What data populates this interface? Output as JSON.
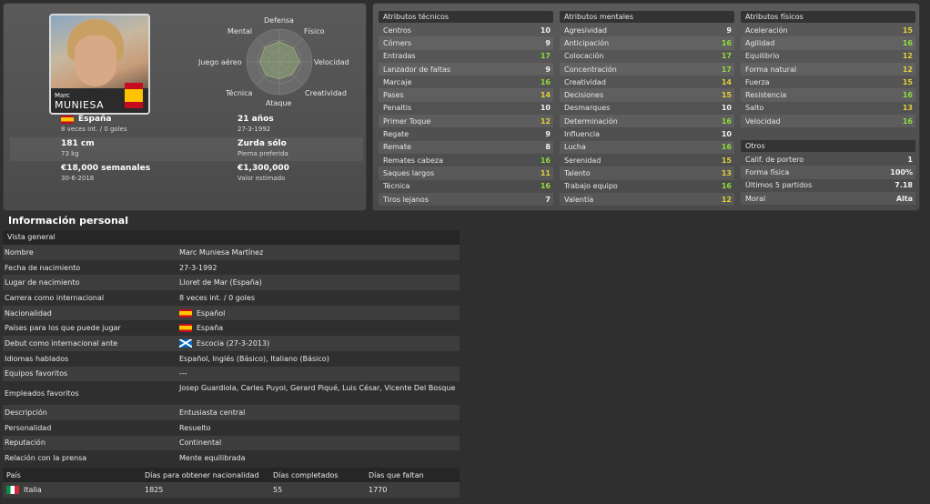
{
  "player": {
    "photo_first": "Marc",
    "photo_last": "MUNIESA",
    "nationality": "España",
    "caps": "8 veces int. / 0 goles",
    "age": "21 años",
    "dob": "27-3-1992",
    "height": "181 cm",
    "weight": "73 kg",
    "foot": "Zurda sólo",
    "foot_label": "Pierna preferida",
    "wage": "€18,000 semanales",
    "contract": "30-6-2018",
    "value": "€1,300,000",
    "value_label": "Valor estimado"
  },
  "radar": {
    "labels": [
      "Defensa",
      "Físico",
      "Velocidad",
      "Creatividad",
      "Ataque",
      "Técnica",
      "Juego aéreo",
      "Mental"
    ],
    "values": [
      0.62,
      0.6,
      0.62,
      0.55,
      0.52,
      0.58,
      0.6,
      0.63
    ]
  },
  "technical": {
    "title": "Atributos técnicos",
    "items": [
      {
        "name": "Centros",
        "value": "10",
        "tone": "w"
      },
      {
        "name": "Córners",
        "value": "9",
        "tone": "w"
      },
      {
        "name": "Entradas",
        "value": "17",
        "tone": "g"
      },
      {
        "name": "Lanzador de faltas",
        "value": "9",
        "tone": "w"
      },
      {
        "name": "Marcaje",
        "value": "16",
        "tone": "g"
      },
      {
        "name": "Pases",
        "value": "14",
        "tone": "y"
      },
      {
        "name": "Penaltis",
        "value": "10",
        "tone": "w"
      },
      {
        "name": "Primer Toque",
        "value": "12",
        "tone": "y"
      },
      {
        "name": "Regate",
        "value": "9",
        "tone": "w"
      },
      {
        "name": "Remate",
        "value": "8",
        "tone": "w"
      },
      {
        "name": "Remates cabeza",
        "value": "16",
        "tone": "g"
      },
      {
        "name": "Saques largos",
        "value": "11",
        "tone": "y"
      },
      {
        "name": "Técnica",
        "value": "16",
        "tone": "g"
      },
      {
        "name": "Tiros lejanos",
        "value": "7",
        "tone": "w"
      }
    ]
  },
  "mental": {
    "title": "Atributos mentales",
    "items": [
      {
        "name": "Agresividad",
        "value": "9",
        "tone": "w"
      },
      {
        "name": "Anticipación",
        "value": "16",
        "tone": "g"
      },
      {
        "name": "Colocación",
        "value": "17",
        "tone": "g"
      },
      {
        "name": "Concentración",
        "value": "17",
        "tone": "g"
      },
      {
        "name": "Creatividad",
        "value": "14",
        "tone": "y"
      },
      {
        "name": "Decisiones",
        "value": "15",
        "tone": "y"
      },
      {
        "name": "Desmarques",
        "value": "10",
        "tone": "w"
      },
      {
        "name": "Determinación",
        "value": "16",
        "tone": "g"
      },
      {
        "name": "Influencia",
        "value": "10",
        "tone": "w"
      },
      {
        "name": "Lucha",
        "value": "16",
        "tone": "g"
      },
      {
        "name": "Serenidad",
        "value": "15",
        "tone": "y"
      },
      {
        "name": "Talento",
        "value": "13",
        "tone": "y"
      },
      {
        "name": "Trabajo equipo",
        "value": "16",
        "tone": "g"
      },
      {
        "name": "Valentía",
        "value": "12",
        "tone": "y"
      }
    ]
  },
  "physical": {
    "title": "Atributos físicos",
    "items": [
      {
        "name": "Aceleración",
        "value": "15",
        "tone": "y"
      },
      {
        "name": "Agilidad",
        "value": "16",
        "tone": "g"
      },
      {
        "name": "Equilibrio",
        "value": "12",
        "tone": "y"
      },
      {
        "name": "Forma natural",
        "value": "12",
        "tone": "y"
      },
      {
        "name": "Fuerza",
        "value": "15",
        "tone": "y"
      },
      {
        "name": "Resistencia",
        "value": "16",
        "tone": "g"
      },
      {
        "name": "Salto",
        "value": "13",
        "tone": "y"
      },
      {
        "name": "Velocidad",
        "value": "16",
        "tone": "g"
      }
    ]
  },
  "others": {
    "title": "Otros",
    "items": [
      {
        "name": "Calif. de portero",
        "value": "1"
      },
      {
        "name": "Forma física",
        "value": "100%"
      },
      {
        "name": "Últimos 5 partidos",
        "value": "7.18"
      },
      {
        "name": "Moral",
        "value": "Alta"
      }
    ]
  },
  "personal": {
    "title": "Información personal",
    "section": "Vista general",
    "rows": [
      {
        "label": "Nombre",
        "value": "Marc Muniesa Martínez",
        "flag": ""
      },
      {
        "label": "Fecha de nacimiento",
        "value": "27-3-1992",
        "flag": ""
      },
      {
        "label": "Lugar de nacimiento",
        "value": "Lloret de Mar (España)",
        "flag": ""
      },
      {
        "label": "Carrera como internacional",
        "value": "8 veces int. / 0 goles",
        "flag": ""
      },
      {
        "label": "Nacionalidad",
        "value": "Español",
        "flag": "es"
      },
      {
        "label": "Países para los que puede jugar",
        "value": "España",
        "flag": "es"
      },
      {
        "label": "Debut como internacional ante",
        "value": "Escocia (27-3-2013)",
        "flag": "sco"
      },
      {
        "label": "Idiomas hablados",
        "value": "Español, Inglés (Básico), Italiano (Básico)",
        "flag": ""
      },
      {
        "label": "Equipos favoritos",
        "value": "---",
        "flag": ""
      },
      {
        "label": "Empleados favoritos",
        "value": "Josep Guardiola, Carles Puyol, Gerard Piqué, Luis César, Vicente Del Bosque",
        "flag": "",
        "tall": true
      },
      {
        "label": "Descripción",
        "value": "Entusiasta central",
        "flag": ""
      },
      {
        "label": "Personalidad",
        "value": "Resuelto",
        "flag": ""
      },
      {
        "label": "Reputación",
        "value": "Continental",
        "flag": ""
      },
      {
        "label": "Relación con la prensa",
        "value": "Mente equilibrada",
        "flag": ""
      }
    ]
  },
  "nationality_table": {
    "headers": [
      "País",
      "Días para obtener nacionalidad",
      "Días completados",
      "Días que faltan"
    ],
    "row": {
      "country": "Italia",
      "days_needed": "1825",
      "days_done": "55",
      "days_left": "1770"
    }
  }
}
